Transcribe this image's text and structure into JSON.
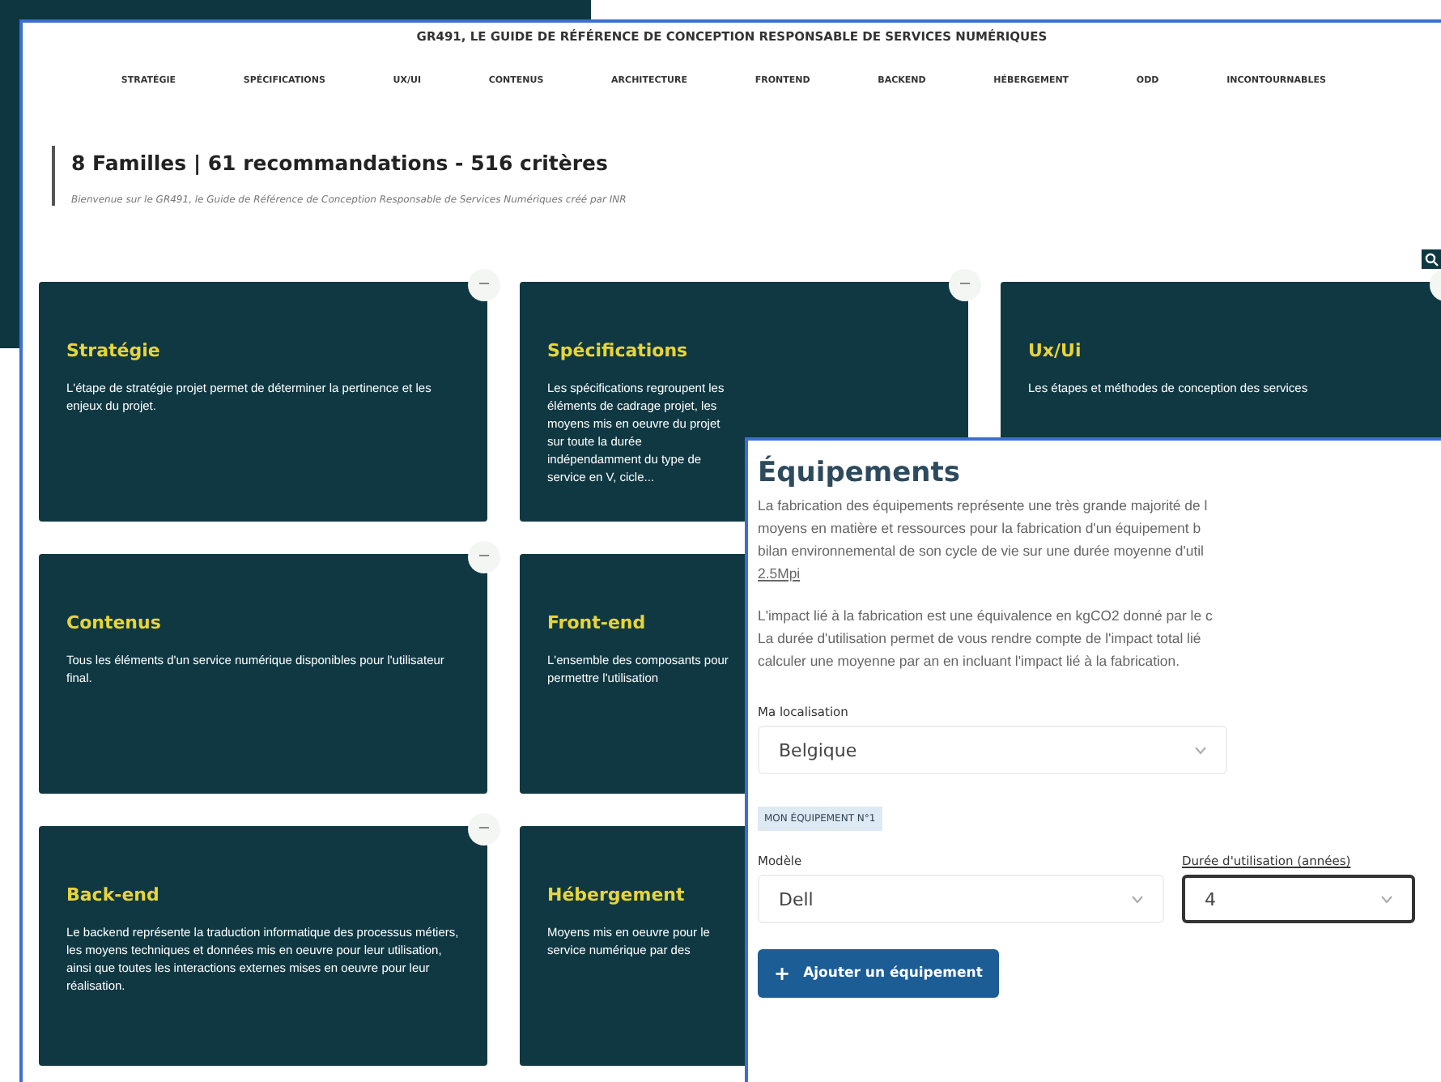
{
  "site_title": "GR491, LE GUIDE DE RÉFÉRENCE DE CONCEPTION RESPONSABLE DE SERVICES NUMÉRIQUES",
  "nav": [
    "STRATÉGIE",
    "SPÉCIFICATIONS",
    "UX/UI",
    "CONTENUS",
    "ARCHITECTURE",
    "FRONTEND",
    "BACKEND",
    "HÉBERGEMENT",
    "ODD",
    "INCONTOURNABLES"
  ],
  "heading": "8 Familles |  61 recommandations - 516 critères",
  "intro": "Bienvenue sur le GR491, le Guide de Référence de Conception Responsable de Services Numériques créé par INR",
  "card_rows": [
    [
      {
        "title": "Stratégie",
        "description": "L'étape de stratégie projet permet de déterminer la pertinence et les enjeux du projet."
      },
      {
        "title": "Spécifications",
        "description": "Les spécifications regroupent les éléments de cadrage projet, les moyens mis en oeuvre du projet sur toute la durée indépendamment du type de service en V, cicle..."
      },
      {
        "title": "Ux/Ui",
        "description": "Les étapes et méthodes de conception des services"
      }
    ],
    [
      {
        "title": "Contenus",
        "description": "Tous les éléments d'un service numérique disponibles pour l'utilisateur final."
      },
      {
        "title": "Front-end",
        "description": "L'ensemble des composants pour permettre l'utilisation"
      }
    ],
    [
      {
        "title": "Back-end",
        "description": "Le backend représente la traduction informatique des processus métiers, les moyens techniques et données mis en oeuvre pour leur utilisation, ainsi que toutes les interactions externes mises en oeuvre pour leur réalisation."
      },
      {
        "title": "Hébergement",
        "description": "Moyens mis en oeuvre pour le service numérique par des"
      }
    ]
  ],
  "equipements": {
    "title": "Équipements",
    "paragraphs": [
      [
        "La fabrication des équipements représente une très grande majorité de l",
        "moyens en matière et ressources pour la fabrication d'un équipement b",
        "bilan environnemental de son cycle de vie sur une durée moyenne d'util"
      ],
      [
        "L'impact lié à la fabrication est une équivalence en kgCO2 donné par le c",
        "La durée d'utilisation permet de vous rendre compte de l'impact total lié",
        "calculer une moyenne par an en incluant l'impact lié à la fabrication."
      ]
    ],
    "link": "2.5Mpi",
    "location": {
      "label": "Ma localisation",
      "value": "Belgique"
    },
    "tag": "MON ÉQUIPEMENT N°1",
    "model": {
      "label": "Modèle",
      "value": "Dell"
    },
    "duration": {
      "label": "Durée d'utilisation (années)",
      "value": "4",
      "focused": true
    },
    "add_button": {
      "icon": "+",
      "label": "Ajouter un équipement"
    }
  }
}
